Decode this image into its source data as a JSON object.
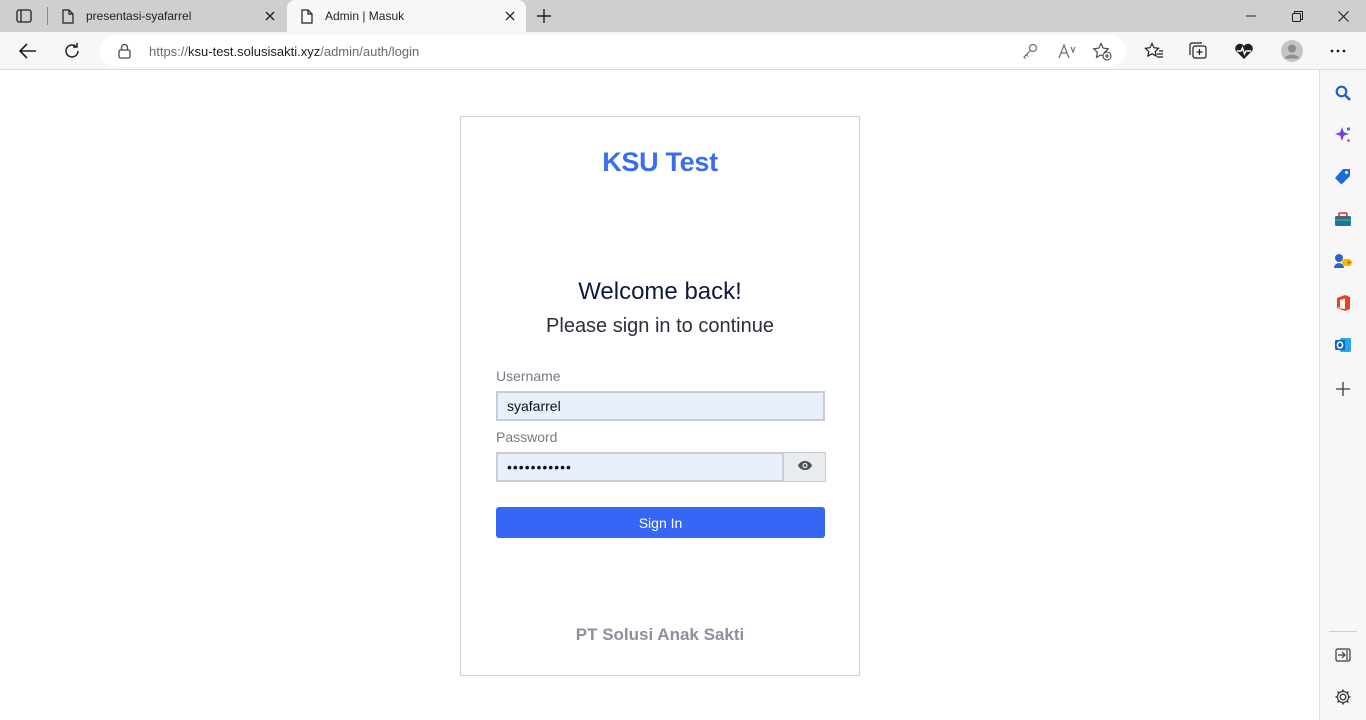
{
  "browser": {
    "tabs": [
      {
        "title": "presentasi-syafarrel",
        "active": false
      },
      {
        "title": "Admin | Masuk",
        "active": true
      }
    ],
    "address": {
      "scheme": "https://",
      "host": "ksu-test.solusisakti.xyz",
      "path": "/admin/auth/login"
    }
  },
  "login": {
    "brand": "KSU Test",
    "welcome": "Welcome back!",
    "subtitle": "Please sign in to continue",
    "username_label": "Username",
    "username_value": "syafarrel",
    "password_label": "Password",
    "password_value": "•••••••••••",
    "submit_label": "Sign In",
    "footer": "PT Solusi Anak Sakti"
  },
  "colors": {
    "brand": "#3a6ef0",
    "primary_button": "#3566f5",
    "autofill_bg": "#e8f0fe"
  },
  "sidebar_icons": [
    "search-icon",
    "copilot-icon",
    "shopping-tag-icon",
    "tools-icon",
    "games-icon",
    "office-icon",
    "outlook-icon",
    "add-icon",
    "hide-sidebar-icon",
    "settings-icon"
  ]
}
